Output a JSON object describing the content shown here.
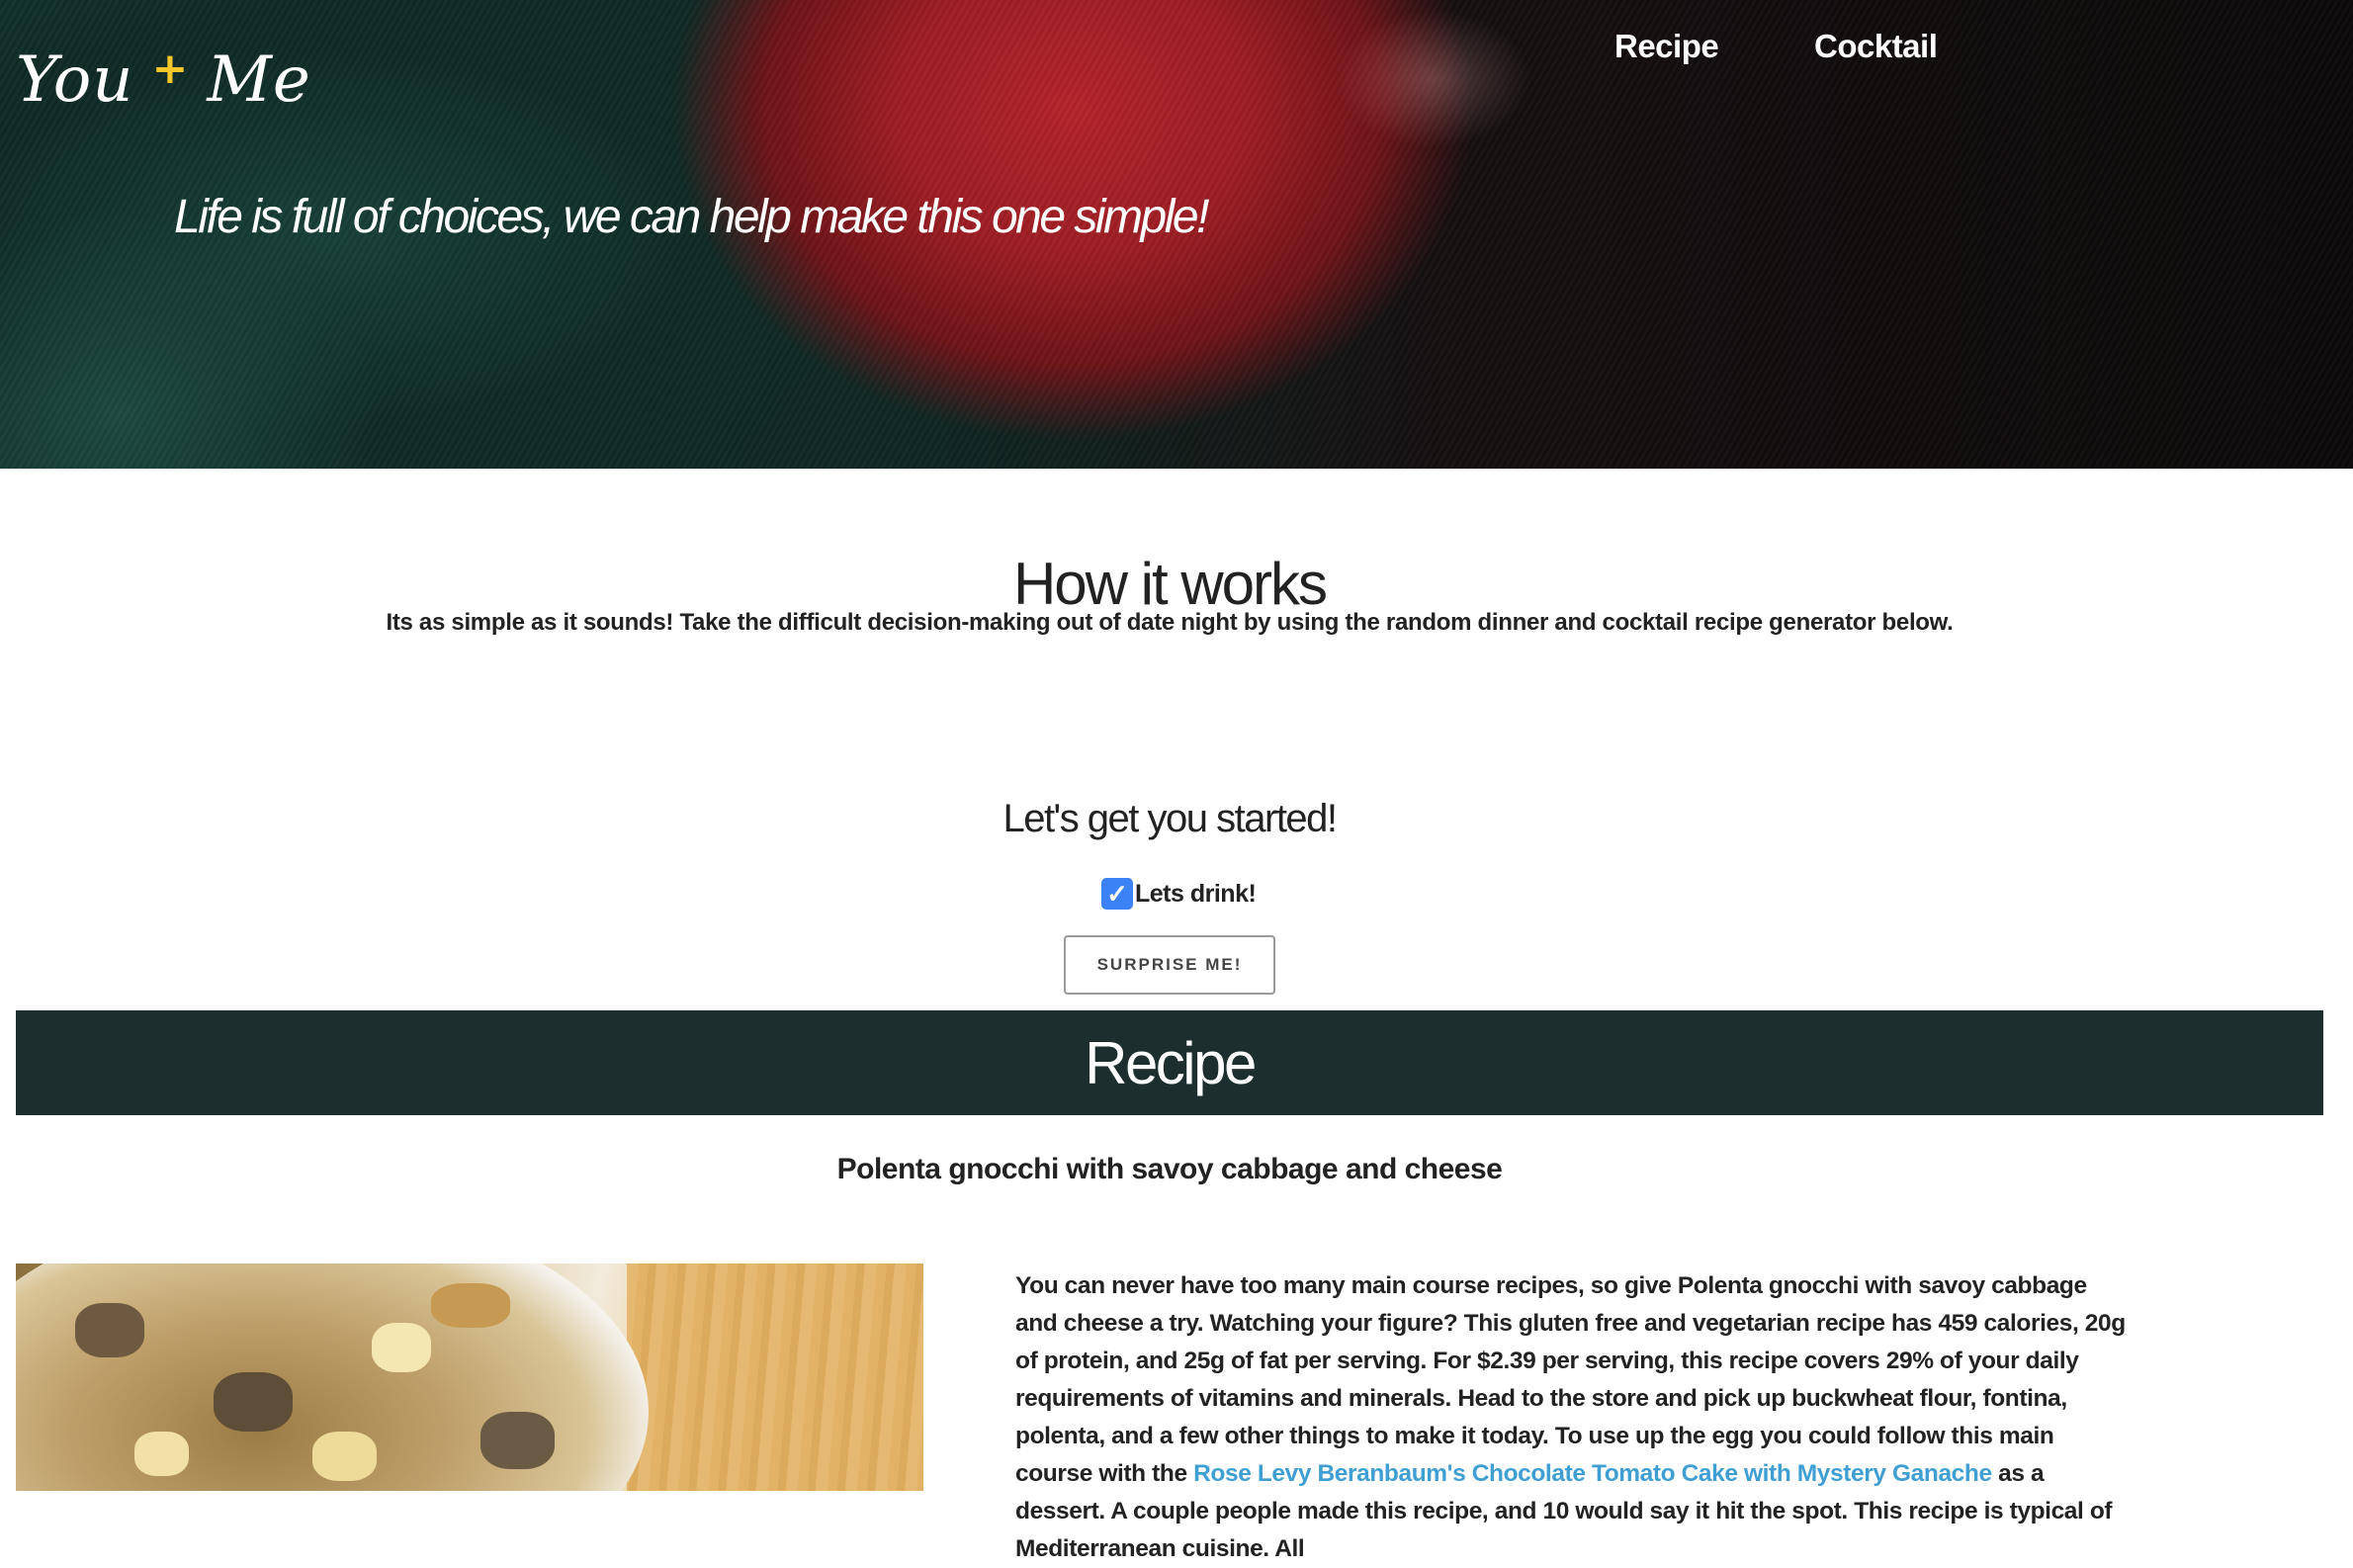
{
  "header": {
    "logo": {
      "left": "You",
      "plus": "+",
      "right": "Me"
    },
    "nav": [
      {
        "label": "Recipe"
      },
      {
        "label": "Cocktail"
      }
    ],
    "tagline": "Life is full of choices, we can help make this one simple!"
  },
  "how_it_works": {
    "title": "How it works",
    "description": "Its as simple as it sounds! Take the difficult decision-making out of date night by using the random dinner and cocktail recipe generator below."
  },
  "start": {
    "title": "Let's get you started!",
    "checkbox_label": "Lets drink!",
    "checkbox_checked": true,
    "button_label": "SURPRISE ME!"
  },
  "recipe": {
    "banner_title": "Recipe",
    "name": "Polenta gnocchi with savoy cabbage and cheese",
    "description_part1": "You can never have too many main course recipes, so give Polenta gnocchi with savoy cabbage and cheese a try. Watching your figure? This gluten free and vegetarian recipe has 459 calories, 20g of protein, and 25g of fat per serving. For $2.39 per serving, this recipe covers 29% of your daily requirements of vitamins and minerals. Head to the store and pick up buckwheat flour, fontina, polenta, and a few other things to make it today. To use up the egg you could follow this main course with the ",
    "description_link": "Rose Levy Beranbaum's Chocolate Tomato Cake with Mystery Ganache",
    "description_part2": " as a dessert. A couple people made this recipe, and 10 would say it hit the spot. This recipe is typical of Mediterranean cuisine. All"
  },
  "colors": {
    "banner_bg": "#1c2e2d",
    "logo_plus": "#f3c62b",
    "link": "#3f9fd2",
    "checkbox": "#3b82f6"
  }
}
